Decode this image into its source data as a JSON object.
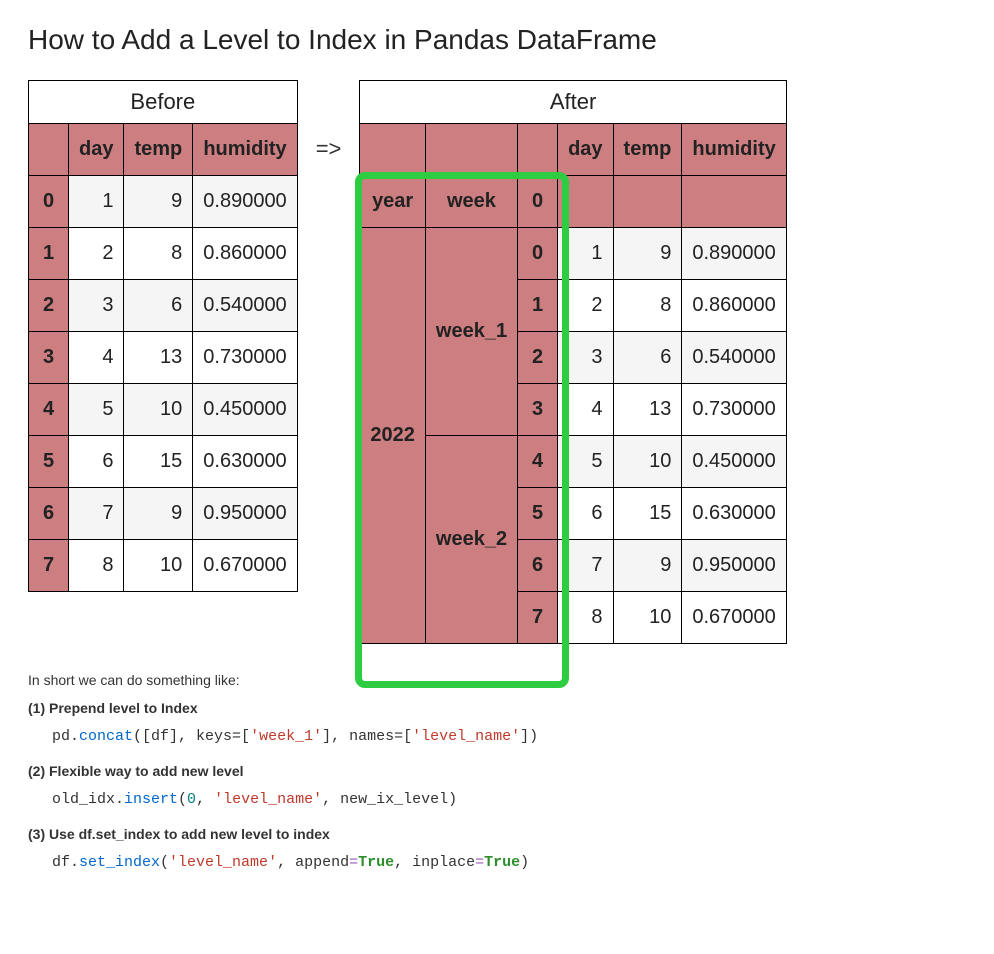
{
  "title": "How to Add a Level to Index in Pandas DataFrame",
  "arrow": "=>",
  "before": {
    "caption": "Before",
    "columns": [
      "day",
      "temp",
      "humidity"
    ],
    "rows": [
      {
        "idx": "0",
        "day": "1",
        "temp": "9",
        "humidity": "0.890000"
      },
      {
        "idx": "1",
        "day": "2",
        "temp": "8",
        "humidity": "0.860000"
      },
      {
        "idx": "2",
        "day": "3",
        "temp": "6",
        "humidity": "0.540000"
      },
      {
        "idx": "3",
        "day": "4",
        "temp": "13",
        "humidity": "0.730000"
      },
      {
        "idx": "4",
        "day": "5",
        "temp": "10",
        "humidity": "0.450000"
      },
      {
        "idx": "5",
        "day": "6",
        "temp": "15",
        "humidity": "0.630000"
      },
      {
        "idx": "6",
        "day": "7",
        "temp": "9",
        "humidity": "0.950000"
      },
      {
        "idx": "7",
        "day": "8",
        "temp": "10",
        "humidity": "0.670000"
      }
    ]
  },
  "after": {
    "caption": "After",
    "columns": [
      "day",
      "temp",
      "humidity"
    ],
    "index_names": {
      "year": "year",
      "week": "week",
      "inner": "0"
    },
    "year_value": "2022",
    "week1": "week_1",
    "week2": "week_2",
    "rows": [
      {
        "idx": "0",
        "day": "1",
        "temp": "9",
        "humidity": "0.890000"
      },
      {
        "idx": "1",
        "day": "2",
        "temp": "8",
        "humidity": "0.860000"
      },
      {
        "idx": "2",
        "day": "3",
        "temp": "6",
        "humidity": "0.540000"
      },
      {
        "idx": "3",
        "day": "4",
        "temp": "13",
        "humidity": "0.730000"
      },
      {
        "idx": "4",
        "day": "5",
        "temp": "10",
        "humidity": "0.450000"
      },
      {
        "idx": "5",
        "day": "6",
        "temp": "15",
        "humidity": "0.630000"
      },
      {
        "idx": "6",
        "day": "7",
        "temp": "9",
        "humidity": "0.950000"
      },
      {
        "idx": "7",
        "day": "8",
        "temp": "10",
        "humidity": "0.670000"
      }
    ]
  },
  "notes": {
    "intro": "In short we can do something like:",
    "item1_title": "(1) Prepend level to Index",
    "item2_title": "(2) Flexible way to add new level",
    "item3_title": "(3) Use df.set_index to add new level to index",
    "code1": {
      "p1": "pd.",
      "fn1": "concat",
      "p2": "([df], keys=[",
      "s1": "'week_1'",
      "p3": "], names=[",
      "s2": "'level_name'",
      "p4": "])"
    },
    "code2": {
      "p1": "old_idx.",
      "fn1": "insert",
      "p2": "(",
      "n1": "0",
      "p3": ", ",
      "s1": "'level_name'",
      "p4": ", new_ix_level)"
    },
    "code3": {
      "p1": "df.",
      "fn1": "set_index",
      "p2": "(",
      "s1": "'level_name'",
      "p3": ", append",
      "op1": "=",
      "kw1": "True",
      "p4": ", inplace",
      "op2": "=",
      "kw2": "True",
      "p5": ")"
    }
  }
}
